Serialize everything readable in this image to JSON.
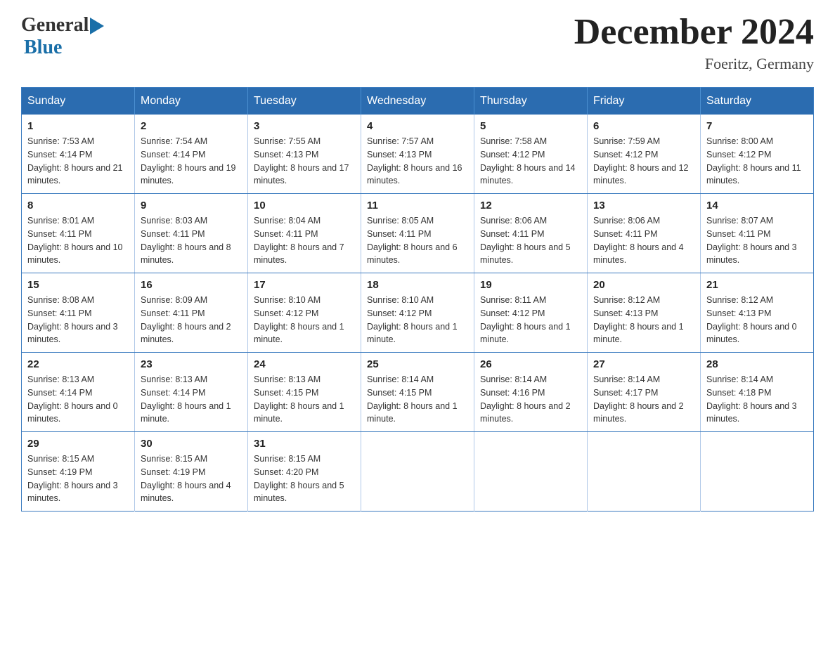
{
  "header": {
    "logo_general": "General",
    "logo_blue": "Blue",
    "title": "December 2024",
    "location": "Foeritz, Germany"
  },
  "calendar": {
    "days_of_week": [
      "Sunday",
      "Monday",
      "Tuesday",
      "Wednesday",
      "Thursday",
      "Friday",
      "Saturday"
    ],
    "weeks": [
      [
        {
          "day": "1",
          "sunrise": "7:53 AM",
          "sunset": "4:14 PM",
          "daylight": "8 hours and 21 minutes."
        },
        {
          "day": "2",
          "sunrise": "7:54 AM",
          "sunset": "4:14 PM",
          "daylight": "8 hours and 19 minutes."
        },
        {
          "day": "3",
          "sunrise": "7:55 AM",
          "sunset": "4:13 PM",
          "daylight": "8 hours and 17 minutes."
        },
        {
          "day": "4",
          "sunrise": "7:57 AM",
          "sunset": "4:13 PM",
          "daylight": "8 hours and 16 minutes."
        },
        {
          "day": "5",
          "sunrise": "7:58 AM",
          "sunset": "4:12 PM",
          "daylight": "8 hours and 14 minutes."
        },
        {
          "day": "6",
          "sunrise": "7:59 AM",
          "sunset": "4:12 PM",
          "daylight": "8 hours and 12 minutes."
        },
        {
          "day": "7",
          "sunrise": "8:00 AM",
          "sunset": "4:12 PM",
          "daylight": "8 hours and 11 minutes."
        }
      ],
      [
        {
          "day": "8",
          "sunrise": "8:01 AM",
          "sunset": "4:11 PM",
          "daylight": "8 hours and 10 minutes."
        },
        {
          "day": "9",
          "sunrise": "8:03 AM",
          "sunset": "4:11 PM",
          "daylight": "8 hours and 8 minutes."
        },
        {
          "day": "10",
          "sunrise": "8:04 AM",
          "sunset": "4:11 PM",
          "daylight": "8 hours and 7 minutes."
        },
        {
          "day": "11",
          "sunrise": "8:05 AM",
          "sunset": "4:11 PM",
          "daylight": "8 hours and 6 minutes."
        },
        {
          "day": "12",
          "sunrise": "8:06 AM",
          "sunset": "4:11 PM",
          "daylight": "8 hours and 5 minutes."
        },
        {
          "day": "13",
          "sunrise": "8:06 AM",
          "sunset": "4:11 PM",
          "daylight": "8 hours and 4 minutes."
        },
        {
          "day": "14",
          "sunrise": "8:07 AM",
          "sunset": "4:11 PM",
          "daylight": "8 hours and 3 minutes."
        }
      ],
      [
        {
          "day": "15",
          "sunrise": "8:08 AM",
          "sunset": "4:11 PM",
          "daylight": "8 hours and 3 minutes."
        },
        {
          "day": "16",
          "sunrise": "8:09 AM",
          "sunset": "4:11 PM",
          "daylight": "8 hours and 2 minutes."
        },
        {
          "day": "17",
          "sunrise": "8:10 AM",
          "sunset": "4:12 PM",
          "daylight": "8 hours and 1 minute."
        },
        {
          "day": "18",
          "sunrise": "8:10 AM",
          "sunset": "4:12 PM",
          "daylight": "8 hours and 1 minute."
        },
        {
          "day": "19",
          "sunrise": "8:11 AM",
          "sunset": "4:12 PM",
          "daylight": "8 hours and 1 minute."
        },
        {
          "day": "20",
          "sunrise": "8:12 AM",
          "sunset": "4:13 PM",
          "daylight": "8 hours and 1 minute."
        },
        {
          "day": "21",
          "sunrise": "8:12 AM",
          "sunset": "4:13 PM",
          "daylight": "8 hours and 0 minutes."
        }
      ],
      [
        {
          "day": "22",
          "sunrise": "8:13 AM",
          "sunset": "4:14 PM",
          "daylight": "8 hours and 0 minutes."
        },
        {
          "day": "23",
          "sunrise": "8:13 AM",
          "sunset": "4:14 PM",
          "daylight": "8 hours and 1 minute."
        },
        {
          "day": "24",
          "sunrise": "8:13 AM",
          "sunset": "4:15 PM",
          "daylight": "8 hours and 1 minute."
        },
        {
          "day": "25",
          "sunrise": "8:14 AM",
          "sunset": "4:15 PM",
          "daylight": "8 hours and 1 minute."
        },
        {
          "day": "26",
          "sunrise": "8:14 AM",
          "sunset": "4:16 PM",
          "daylight": "8 hours and 2 minutes."
        },
        {
          "day": "27",
          "sunrise": "8:14 AM",
          "sunset": "4:17 PM",
          "daylight": "8 hours and 2 minutes."
        },
        {
          "day": "28",
          "sunrise": "8:14 AM",
          "sunset": "4:18 PM",
          "daylight": "8 hours and 3 minutes."
        }
      ],
      [
        {
          "day": "29",
          "sunrise": "8:15 AM",
          "sunset": "4:19 PM",
          "daylight": "8 hours and 3 minutes."
        },
        {
          "day": "30",
          "sunrise": "8:15 AM",
          "sunset": "4:19 PM",
          "daylight": "8 hours and 4 minutes."
        },
        {
          "day": "31",
          "sunrise": "8:15 AM",
          "sunset": "4:20 PM",
          "daylight": "8 hours and 5 minutes."
        },
        null,
        null,
        null,
        null
      ]
    ]
  }
}
